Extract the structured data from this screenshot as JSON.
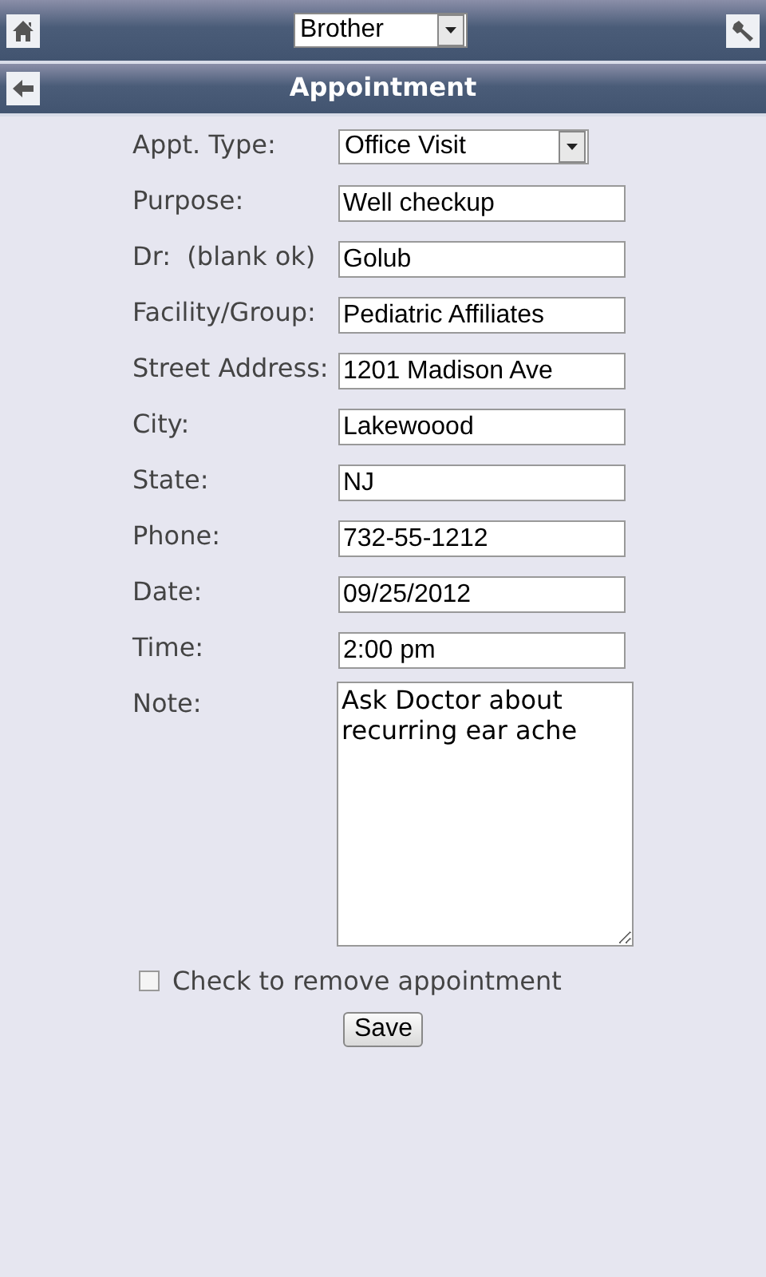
{
  "top_bar": {
    "person_select": "Brother"
  },
  "title_bar": {
    "title": "Appointment"
  },
  "fields": [
    {
      "kind": "select",
      "label": "Appt. Type:",
      "value": "Office Visit"
    },
    {
      "kind": "text",
      "label": "Purpose:",
      "value": "Well checkup"
    },
    {
      "kind": "text",
      "label": "Dr:  (blank ok)",
      "value": "Golub"
    },
    {
      "kind": "text",
      "label": "Facility/Group:",
      "value": "Pediatric Affiliates"
    },
    {
      "kind": "text",
      "label": "Street Address:",
      "value": "1201 Madison Ave"
    },
    {
      "kind": "text",
      "label": "City:",
      "value": "Lakewoood"
    },
    {
      "kind": "text",
      "label": "State:",
      "value": "NJ"
    },
    {
      "kind": "text",
      "label": "Phone:",
      "value": "732-55-1212"
    },
    {
      "kind": "text",
      "label": "Date:",
      "value": "09/25/2012"
    },
    {
      "kind": "text",
      "label": "Time:",
      "value": "2:00 pm"
    },
    {
      "kind": "textarea",
      "label": "Note:",
      "value": "Ask Doctor about recurring ear ache"
    }
  ],
  "remove_checkbox": {
    "label": "Check to remove appointment",
    "checked": false
  },
  "buttons": [
    "Save"
  ]
}
